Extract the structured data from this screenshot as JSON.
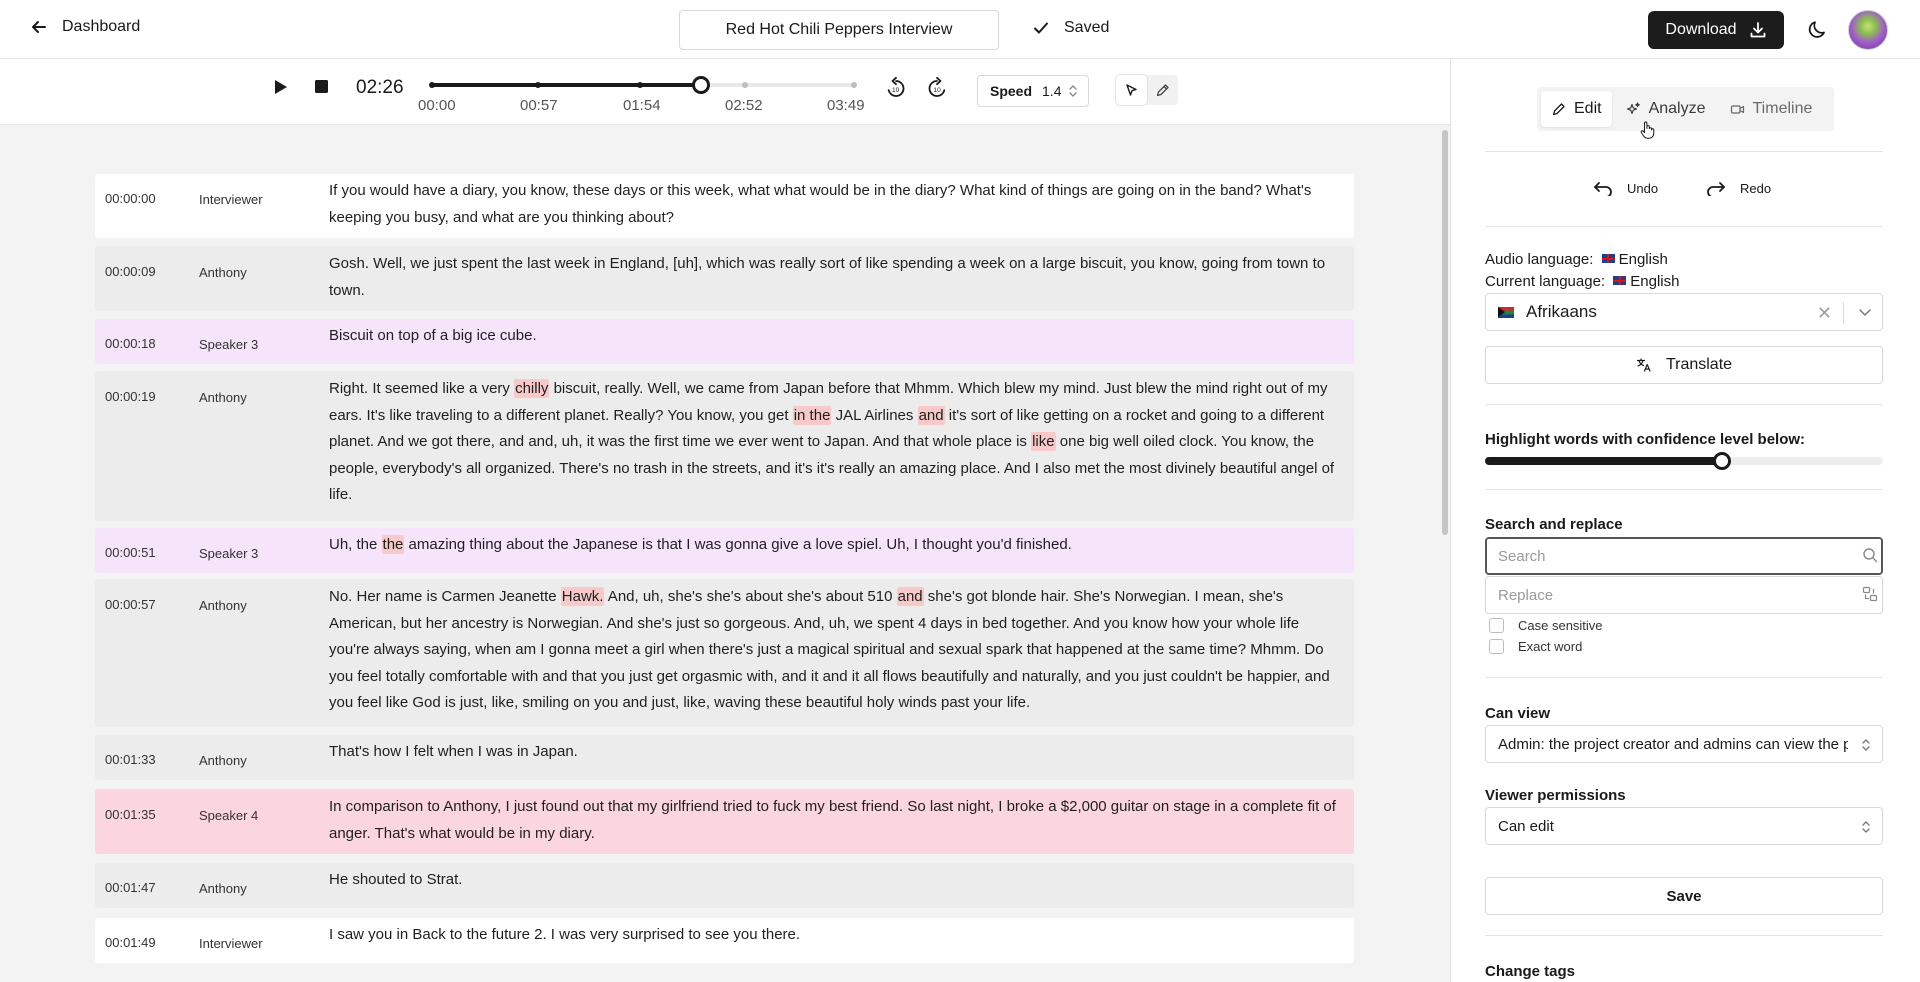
{
  "header": {
    "back_label": "Dashboard",
    "project_title": "Red Hot Chili Peppers Interview",
    "saved_label": "Saved",
    "download_label": "Download"
  },
  "player": {
    "current_time": "02:26",
    "progress_fraction": 0.638,
    "ticks": [
      "00:00",
      "00:57",
      "01:54",
      "02:52",
      "03:49"
    ],
    "speed_label": "Speed",
    "speed_value": "1.4"
  },
  "transcript": [
    {
      "time": "00:00:00",
      "speaker": "Interviewer",
      "style": "white",
      "parts": [
        [
          "If you would have a diary, you know, these days or this week, what what would be in the diary? What kind of things are going on in the band? What's keeping you busy, and what are you thinking about?",
          false
        ]
      ]
    },
    {
      "time": "00:00:09",
      "speaker": "Anthony",
      "style": "grey",
      "parts": [
        [
          "Gosh. Well, we just spent the last week in England, [uh], which was really sort of like spending a week on a large biscuit, you know, going from town to town.",
          false
        ]
      ]
    },
    {
      "time": "00:00:18",
      "speaker": "Speaker 3",
      "style": "purple",
      "parts": [
        [
          "Biscuit on top of a big ice cube.",
          false
        ]
      ]
    },
    {
      "time": "00:00:19",
      "speaker": "Anthony",
      "style": "grey",
      "parts": [
        [
          "Right. It seemed like a very ",
          false
        ],
        [
          "chilly",
          true
        ],
        [
          " biscuit, really. Well, we came from Japan before that Mhmm. Which blew my mind. Just blew the mind right out of my ears. It's like traveling to a different planet. Really? You know, you get ",
          false
        ],
        [
          "in the",
          true
        ],
        [
          " JAL Airlines ",
          false
        ],
        [
          "and",
          true
        ],
        [
          " it's sort of like getting on a rocket and going to a different planet. And we got there, and and, uh, it was the first time we ever went to Japan. And that whole place is ",
          false
        ],
        [
          "like",
          true
        ],
        [
          " one big well oiled clock. You know, the people, everybody's all organized. There's no trash in the streets, and it's it's really an amazing place. And I also met the most divinely beautiful angel of life.",
          false
        ]
      ]
    },
    {
      "time": "00:00:51",
      "speaker": "Speaker 3",
      "style": "purple",
      "parts": [
        [
          "Uh, the ",
          false
        ],
        [
          "the",
          true
        ],
        [
          " amazing thing about the Japanese is that I was gonna give a love spiel. Uh, I thought you'd finished.",
          false
        ]
      ]
    },
    {
      "time": "00:00:57",
      "speaker": "Anthony",
      "style": "grey",
      "parts": [
        [
          "No. Her name is Carmen Jeanette ",
          false
        ],
        [
          "Hawk.",
          true
        ],
        [
          " And, uh, she's she's about she's about 510 ",
          false
        ],
        [
          "and",
          true
        ],
        [
          " she's got blonde hair. She's Norwegian. I mean, she's American, but her ancestry is Norwegian. And she's just so gorgeous. And, uh, we spent 4 days in bed together. And you know how your whole life you're always saying, when am I gonna meet a girl when there's just a magical spiritual and sexual spark that happened at the same time? Mhmm. Do you feel totally comfortable with and that you just get orgasmic with, and it and it all flows beautifully and naturally, and you just couldn't be happier, and you feel like God is just, like, smiling on you and just, like, waving these beautiful holy winds past your life.",
          false
        ]
      ]
    },
    {
      "time": "00:01:33",
      "speaker": "Anthony",
      "style": "grey",
      "parts": [
        [
          "That's how I felt when I was in Japan.",
          false
        ]
      ]
    },
    {
      "time": "00:01:35",
      "speaker": "Speaker 4",
      "style": "pink",
      "parts": [
        [
          "In comparison to Anthony, I just found out that my girlfriend tried to fuck my best friend. So last night, I broke a $2,000 guitar on stage in a complete fit of anger. That's what would be in my diary.",
          false
        ]
      ]
    },
    {
      "time": "00:01:47",
      "speaker": "Anthony",
      "style": "grey",
      "parts": [
        [
          "He shouted to Strat.",
          false
        ]
      ]
    },
    {
      "time": "00:01:49",
      "speaker": "Interviewer",
      "style": "white",
      "parts": [
        [
          "I saw you in Back to the future 2. I was very surprised to see you there.",
          false
        ]
      ]
    }
  ],
  "sidebar": {
    "tabs": [
      "Edit",
      "Analyze",
      "Timeline"
    ],
    "active_tab": "Edit",
    "undo_label": "Undo",
    "redo_label": "Redo",
    "audio_language_label": "Audio language:",
    "audio_language": "English",
    "current_language_label": "Current language:",
    "current_language": "English",
    "target_language": "Afrikaans",
    "translate_label": "Translate",
    "confidence_label": "Highlight words with confidence level below:",
    "confidence_fraction": 0.595,
    "search_replace_label": "Search and replace",
    "search_placeholder": "Search",
    "replace_placeholder": "Replace",
    "case_sensitive_label": "Case sensitive",
    "exact_word_label": "Exact word",
    "can_view_label": "Can view",
    "can_view_value": "Admin: the project creator and admins can view the project",
    "viewer_permissions_label": "Viewer permissions",
    "viewer_permissions_value": "Can edit",
    "save_label": "Save",
    "change_tags_label": "Change tags"
  }
}
